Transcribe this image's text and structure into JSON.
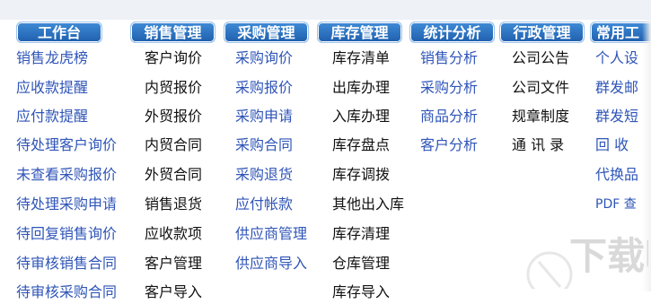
{
  "tabs": [
    {
      "label": "工作台"
    },
    {
      "label": "销售管理"
    },
    {
      "label": "采购管理"
    },
    {
      "label": "库存管理"
    },
    {
      "label": "统计分析"
    },
    {
      "label": "行政管理"
    },
    {
      "label": "常用工"
    }
  ],
  "workbench": {
    "items": [
      "销售龙虎榜",
      "应收款提醒",
      "应付款提醒",
      "待处理客户询价",
      "未查看采购报价",
      "待处理采购申请",
      "待回复销售询价",
      "待审核销售合同",
      "待审核采购合同"
    ]
  },
  "sales": {
    "items": [
      "客户询价",
      "内贸报价",
      "外贸报价",
      "内贸合同",
      "外贸合同",
      "销售退货",
      "应收款项",
      "客户管理",
      "客户导入"
    ]
  },
  "purchase": {
    "items": [
      "采购询价",
      "采购报价",
      "采购申请",
      "采购合同",
      "采购退货",
      "应付帐款",
      "供应商管理",
      "供应商导入"
    ]
  },
  "inventory": {
    "items": [
      "库存清单",
      "出库办理",
      "入库办理",
      "库存盘点",
      "库存调拨",
      "其他出入库",
      "库存清理",
      "仓库管理",
      "库存导入"
    ]
  },
  "stats": {
    "items": [
      "销售分析",
      "采购分析",
      "商品分析",
      "客户分析"
    ]
  },
  "admin": {
    "items": [
      "公司公告",
      "公司文件",
      "规章制度",
      "通 讯 录"
    ]
  },
  "common": {
    "items": [
      "个人设",
      "群发邮",
      "群发短",
      "回 收",
      "代换品",
      "PDF 查"
    ]
  },
  "colors": {
    "tab_blue": "#2f6fc4",
    "link_blue": "#2f55b8",
    "text_black": "#111111"
  },
  "watermark_text": "下载吧"
}
